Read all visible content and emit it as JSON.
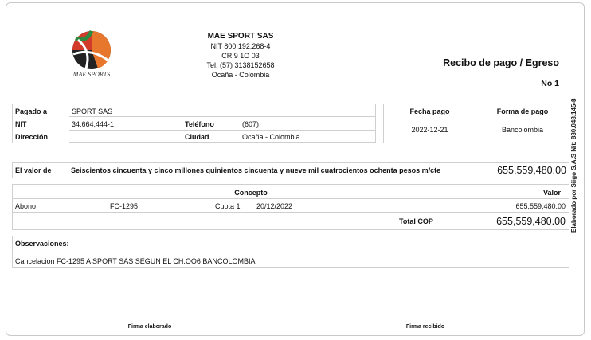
{
  "company": {
    "name": "MAE SPORT SAS",
    "nit": "NIT 800.192.268-4",
    "address": "CR 9 1O 03",
    "phone": "Tel: (57) 3138152658",
    "city": "Ocaña - Colombia",
    "logo_text": "MAE SPORTS"
  },
  "receipt": {
    "title": "Recibo de pago / Egreso",
    "number": "No 1"
  },
  "payee": {
    "paid_to_label": "Pagado a",
    "paid_to": "SPORT SAS",
    "nit_label": "NIT",
    "nit": "34.664.444-1",
    "phone_label": "Teléfono",
    "phone": "(607)",
    "address_label": "Dirección",
    "address": "",
    "city_label": "Ciudad",
    "city": "Ocaña - Colombia"
  },
  "payment": {
    "date_label": "Fecha pago",
    "date": "2022-12-21",
    "method_label": "Forma de pago",
    "method": "Bancolombia"
  },
  "amount": {
    "label": "El valor de",
    "words": "Seiscientos cincuenta y cinco millones quinientos cincuenta y nueve mil cuatrocientos ochenta pesos m/cte",
    "value": "655,559,480.00"
  },
  "concepts": {
    "concept_header": "Concepto",
    "value_header": "Valor",
    "row": {
      "type": "Abono",
      "invoice": "FC-1295",
      "quota": "Cuota 1",
      "date": "20/12/2022",
      "value": "655,559,480.00"
    },
    "total_label": "Total COP",
    "total": "655,559,480.00"
  },
  "observations": {
    "label": "Observaciones:",
    "text": "Cancelacion FC-1295 A SPORT SAS SEGUN EL CH.OO6 BANCOLOMBIA"
  },
  "signatures": {
    "prepared": "Firma elaborado",
    "received": "Firma recibido"
  },
  "side_text": "Elaborado por Siigo S.A.S Nit: 830.048.145-8"
}
